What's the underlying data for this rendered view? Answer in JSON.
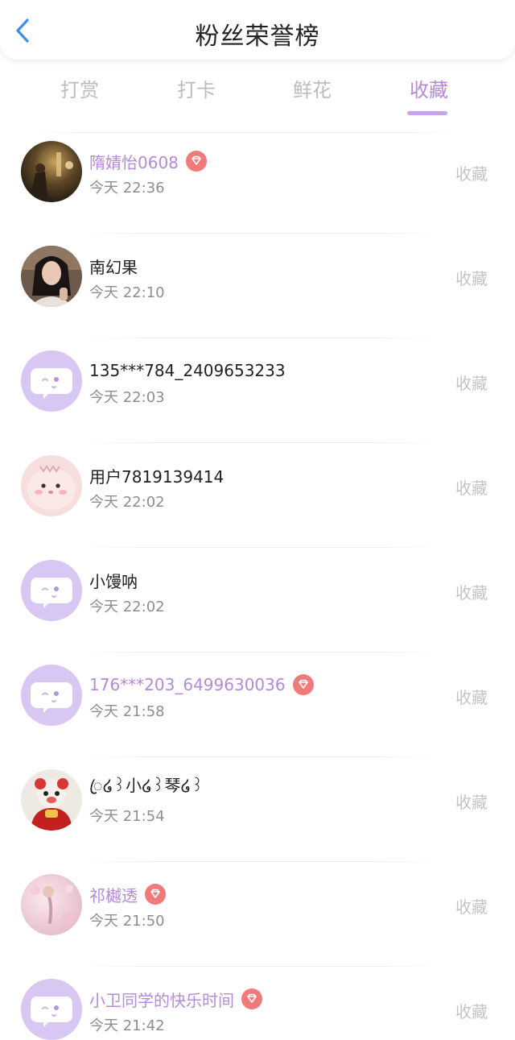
{
  "header": {
    "title": "粉丝荣誉榜"
  },
  "tabs": [
    {
      "label": "打赏",
      "active": false
    },
    {
      "label": "打卡",
      "active": false
    },
    {
      "label": "鲜花",
      "active": false
    },
    {
      "label": "收藏",
      "active": true
    }
  ],
  "colors": {
    "accent": "#b58ad9",
    "badge": "#f07a7a",
    "default_avatar": "#d8c7f2"
  },
  "fans": [
    {
      "name": "隋婧怡0608",
      "vip": true,
      "time": "今天 22:36",
      "action": "收藏",
      "avatar": "photo-night-street"
    },
    {
      "name": "南幻果",
      "vip": false,
      "time": "今天 22:10",
      "action": "收藏",
      "avatar": "photo-woman-portrait"
    },
    {
      "name": "135***784_2409653233",
      "vip": false,
      "time": "今天 22:03",
      "action": "收藏",
      "avatar": "default-chat-avatar"
    },
    {
      "name": "用户7819139414",
      "vip": false,
      "time": "今天 22:02",
      "action": "收藏",
      "avatar": "cartoon-pink-seal"
    },
    {
      "name": "小馒呐",
      "vip": false,
      "time": "今天 22:02",
      "action": "收藏",
      "avatar": "default-chat-avatar"
    },
    {
      "name": "176***203_6499630036",
      "vip": true,
      "time": "今天 21:58",
      "action": "收藏",
      "avatar": "default-chat-avatar"
    },
    {
      "name": "ꦿ໒꒱小໒꒱琴໒꒱",
      "vip": false,
      "time": "今天 21:54",
      "action": "收藏",
      "avatar": "cartoon-red-doll"
    },
    {
      "name": "祁樾透",
      "vip": true,
      "time": "今天 21:50",
      "action": "收藏",
      "avatar": "photo-pink-blossom"
    },
    {
      "name": "小卫同学的快乐时间",
      "vip": true,
      "time": "今天 21:42",
      "action": "收藏",
      "avatar": "default-chat-avatar"
    }
  ]
}
